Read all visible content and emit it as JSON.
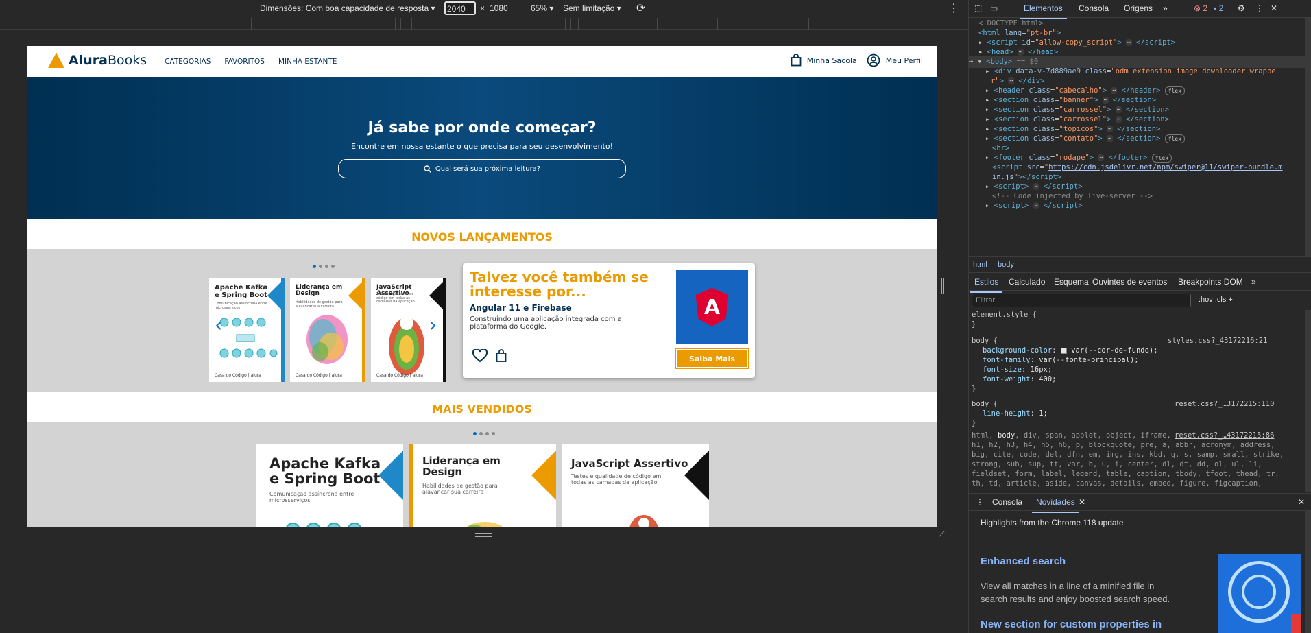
{
  "device_toolbar": {
    "dimensions_label": "Dimensões: Com boa capacidade de resposta ▾",
    "width": "2040",
    "x": "×",
    "height": "1080",
    "zoom": "65% ▾",
    "throttle": "Sem limitação ▾"
  },
  "site": {
    "logo_bold": "Alura",
    "logo_rest": "Books",
    "nav": [
      "CATEGORIAS",
      "FAVORITOS",
      "MINHA ESTANTE"
    ],
    "bag_label": "Minha Sacola",
    "profile_label": "Meu Perfil",
    "banner_title": "Já sabe por onde começar?",
    "banner_subtitle": "Encontre em nossa estante o que precisa para seu desenvolvimento!",
    "search_placeholder": "Qual será sua próxima leitura?",
    "new_releases_title": "NOVOS LANÇAMENTOS",
    "best_sellers_title": "MAIS VENDIDOS",
    "books": [
      {
        "title": "Apache Kafka e Spring Boot",
        "subtitle": "Comunicação assíncrona entre microsserviços",
        "accent": "#1e88c8",
        "footer": "Casa do Código | alura"
      },
      {
        "title": "Liderança em Design",
        "subtitle": "Habilidades de gestão para alavancar sua carreira",
        "accent": "#eb9b00",
        "footer": "Casa do Código | alura"
      },
      {
        "title": "JavaScript Assertivo",
        "subtitle": "Testes e qualidade de código em todas as camadas da aplicação",
        "accent": "#111111",
        "footer": "Casa do Código | alura"
      }
    ],
    "card": {
      "heading": "Talvez você também se interesse por...",
      "book_title": "Angular 11 e Firebase",
      "description": "Construindo uma aplicação integrada com a plataforma do Google.",
      "cta": "Saiba Mais",
      "cover_letter": "A"
    }
  },
  "devtools": {
    "tabs": [
      "Elementos",
      "Consola",
      "Origens"
    ],
    "errors": "2",
    "messages": "2",
    "breadcrumbs": [
      "html",
      "body"
    ],
    "styles_tabs": [
      "Estilos",
      "Calculado",
      "Esquema",
      "Ouvintes de eventos",
      "Breakpoints DOM"
    ],
    "filter_placeholder": "Filtrar",
    "filter_tools": ":hov  .cls  +",
    "drawer_tabs": [
      "Consola",
      "Novidades"
    ],
    "whats_new_header": "Highlights from the Chrome 118 update",
    "whats_new_h1": "Enhanced search",
    "whats_new_p": "View all matches in a line of a minified file in search results and enjoy boosted search speed.",
    "whats_new_h2": "New section for custom properties in"
  },
  "colors": {
    "brand_orange": "#eb9b00",
    "brand_navy": "#002f52",
    "devtools_accent": "#a8c7fa"
  }
}
